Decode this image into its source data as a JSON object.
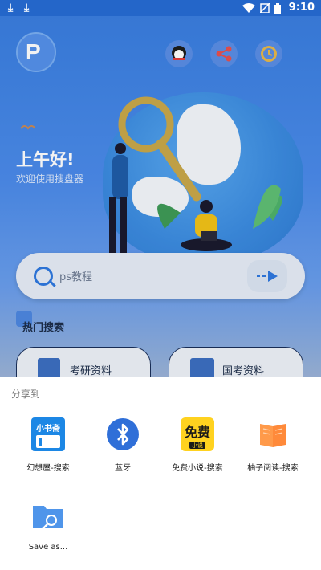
{
  "status_bar": {
    "time": "9:10"
  },
  "app": {
    "greeting": "上午好!",
    "welcome": "欢迎使用搜盘器",
    "search": {
      "query": "ps教程"
    },
    "hot_title": "热门搜索",
    "hot_items": [
      {
        "label": "考研资料"
      },
      {
        "label": "国考资料"
      }
    ]
  },
  "share_sheet": {
    "title": "分享到",
    "targets": [
      {
        "label": "幻想屋-搜索",
        "icon": "xiaoshuzhai-app-icon",
        "icon_text": "小书斋"
      },
      {
        "label": "蓝牙",
        "icon": "bluetooth-icon"
      },
      {
        "label": "免费小说-搜索",
        "icon": "free-novel-app-icon",
        "icon_text": "免费",
        "icon_subtext": "小说"
      },
      {
        "label": "柚子阅读-搜索",
        "icon": "book-reader-icon"
      },
      {
        "label": "Save as...",
        "icon": "save-folder-icon"
      }
    ]
  },
  "colors": {
    "primary_blue": "#2f79e0",
    "sheet_bg": "#ffffff",
    "bluetooth": "#2f6fd8"
  }
}
